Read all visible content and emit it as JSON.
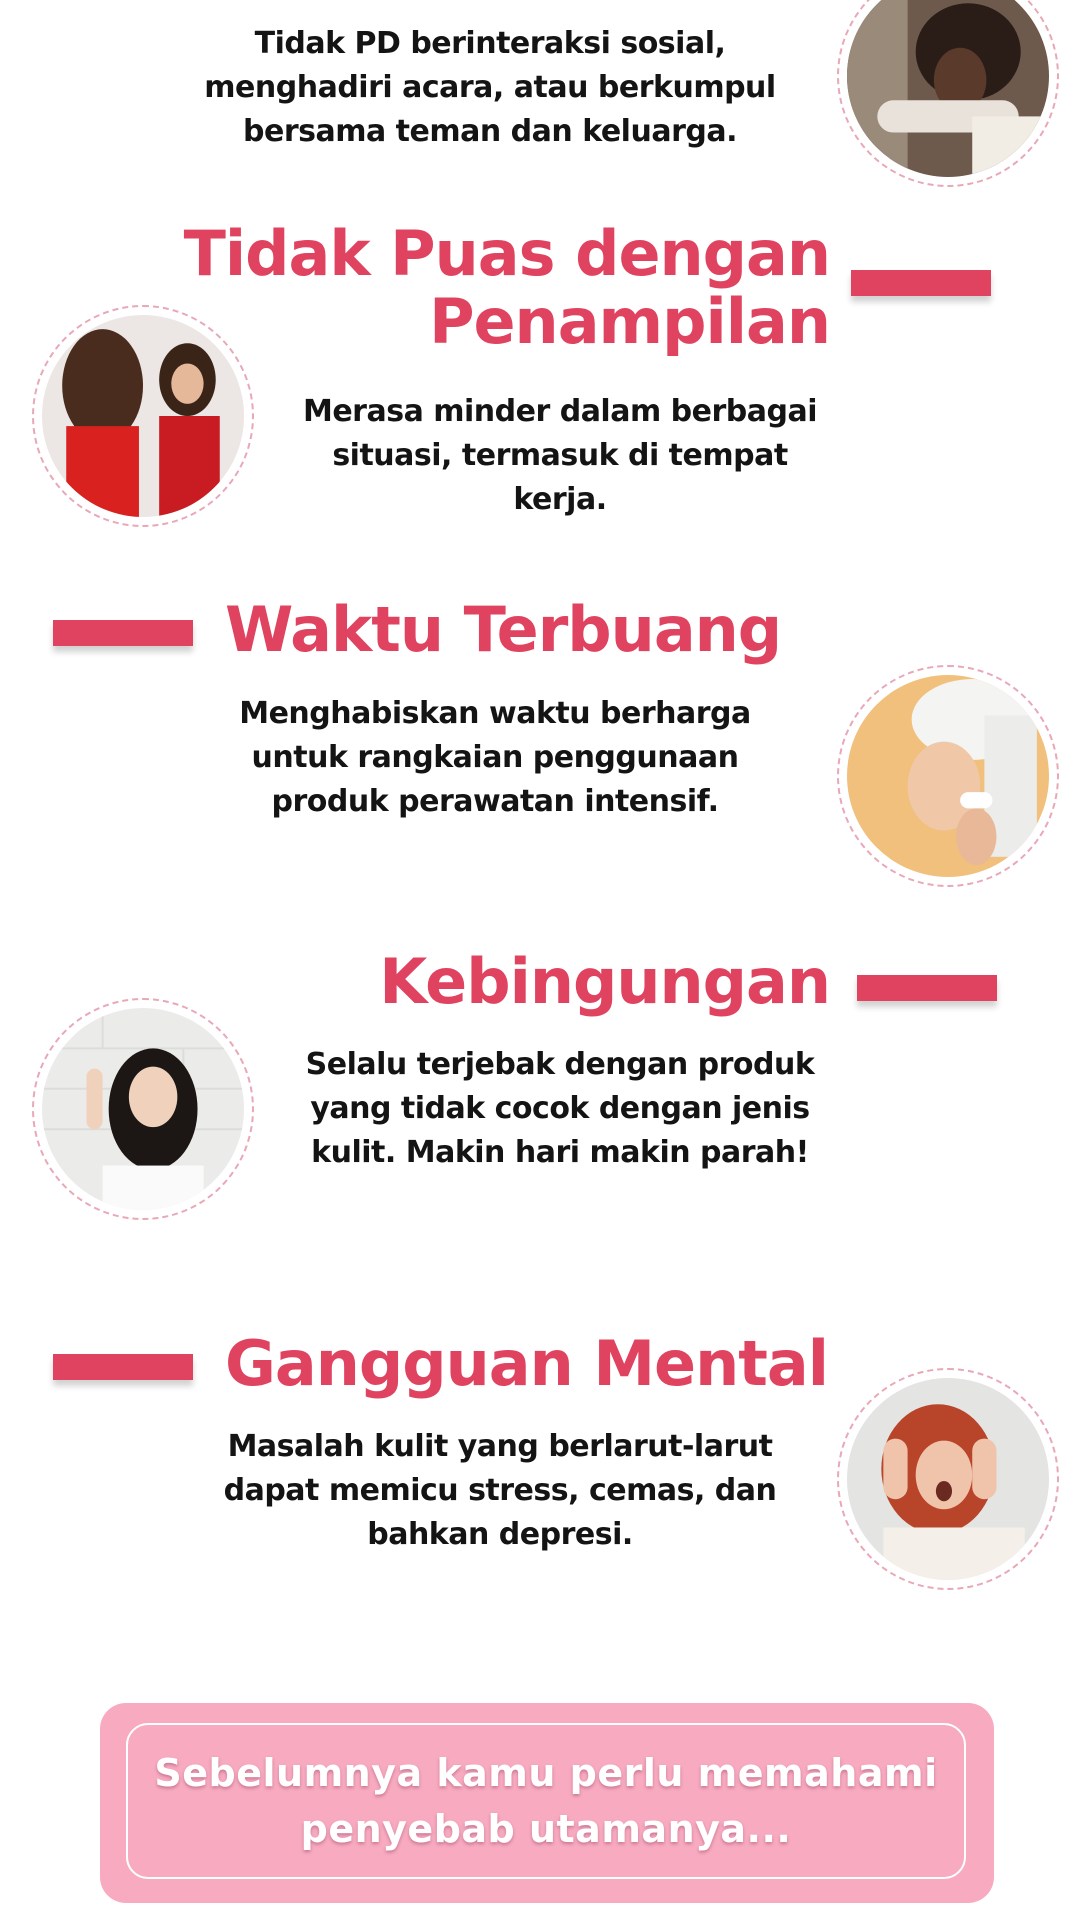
{
  "sections": [
    {
      "title_lines": [],
      "desc_lines": [
        "Tidak PD berinteraksi sosial,",
        "menghadiri acara, atau berkumpul",
        "bersama teman dan keluarga."
      ],
      "photo": "woman-resting-chin-photo"
    },
    {
      "title_lines": [
        "Tidak Puas dengan",
        "Penampilan"
      ],
      "desc_lines": [
        "Merasa minder dalam berbagai",
        "situasi, termasuk di tempat kerja."
      ],
      "photo": "woman-red-dress-mirror-photo"
    },
    {
      "title_lines": [
        "Waktu Terbuang"
      ],
      "desc_lines": [
        "Menghabiskan waktu berharga",
        "untuk rangkaian penggunaan",
        "produk perawatan intensif."
      ],
      "photo": "woman-towel-face-roller-photo"
    },
    {
      "title_lines": [
        "Kebingungan"
      ],
      "desc_lines": [
        "Selalu terjebak dengan produk",
        "yang tidak cocok dengan jenis",
        "kulit. Makin hari makin parah!"
      ],
      "photo": "woman-confused-hair-photo"
    },
    {
      "title_lines": [
        "Gangguan Mental"
      ],
      "desc_lines": [
        "Masalah kulit yang berlarut-larut",
        "dapat memicu stress, cemas, dan",
        "bahkan depresi."
      ],
      "photo": "woman-stressed-screaming-photo"
    }
  ],
  "cta": {
    "lines": [
      "Sebelumnya kamu perlu memahami",
      "penyebab utamanya..."
    ]
  },
  "colors": {
    "accent": "#e0435f",
    "cta_background": "#f7aac0",
    "ring": "#e8a8b6"
  }
}
